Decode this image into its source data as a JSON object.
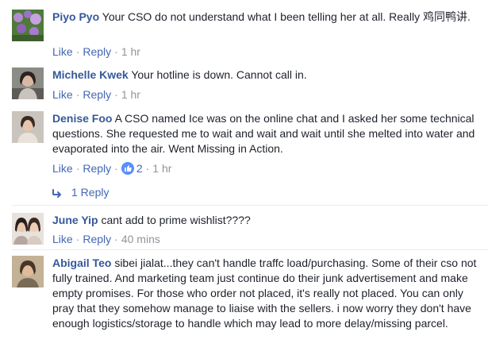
{
  "comments": [
    {
      "author": "Piyo Pyo",
      "text": "Your CSO do not understand what I been telling her at all. Really 鸡同鸭讲.",
      "like_label": "Like",
      "reply_label": "Reply",
      "time": "1 hr",
      "avatar": "flower-garden-avatar"
    },
    {
      "author": "Michelle Kwek",
      "text": "Your hotline is down. Cannot call in.",
      "like_label": "Like",
      "reply_label": "Reply",
      "time": "1 hr",
      "avatar": "woman-portrait-avatar"
    },
    {
      "author": "Denise Foo",
      "text": "A CSO named Ice was on the online chat and I asked her some technical questions. She requested me to wait and wait and wait until she melted into water and evaporated into the air. Went Missing in Action.",
      "like_label": "Like",
      "reply_label": "Reply",
      "likes": "2",
      "time": "1 hr",
      "replies_label": "1 Reply",
      "avatar": "woman-portrait-avatar"
    },
    {
      "author": "June Yip",
      "text": "cant add to prime wishlist????",
      "like_label": "Like",
      "reply_label": "Reply",
      "time": "40 mins",
      "avatar": "two-women-avatar"
    },
    {
      "author": "Abigail Teo",
      "text": "sibei jialat...they can't handle traffc load/purchasing. Some of their cso not fully trained. And marketing team just continue do their junk advertisement and make empty promises. For those who order not placed, it's really not placed. You can only pray that they somehow manage to liaise with the sellers. i now worry they don't have enough logistics/storage to handle which may lead to more delay/missing parcel.",
      "avatar": "woman-portrait-avatar"
    }
  ],
  "colors": {
    "author": "#365899",
    "link": "#4267b2",
    "meta": "#90949c",
    "divider": "#e9ebee",
    "like_badge": "#5890ff"
  }
}
